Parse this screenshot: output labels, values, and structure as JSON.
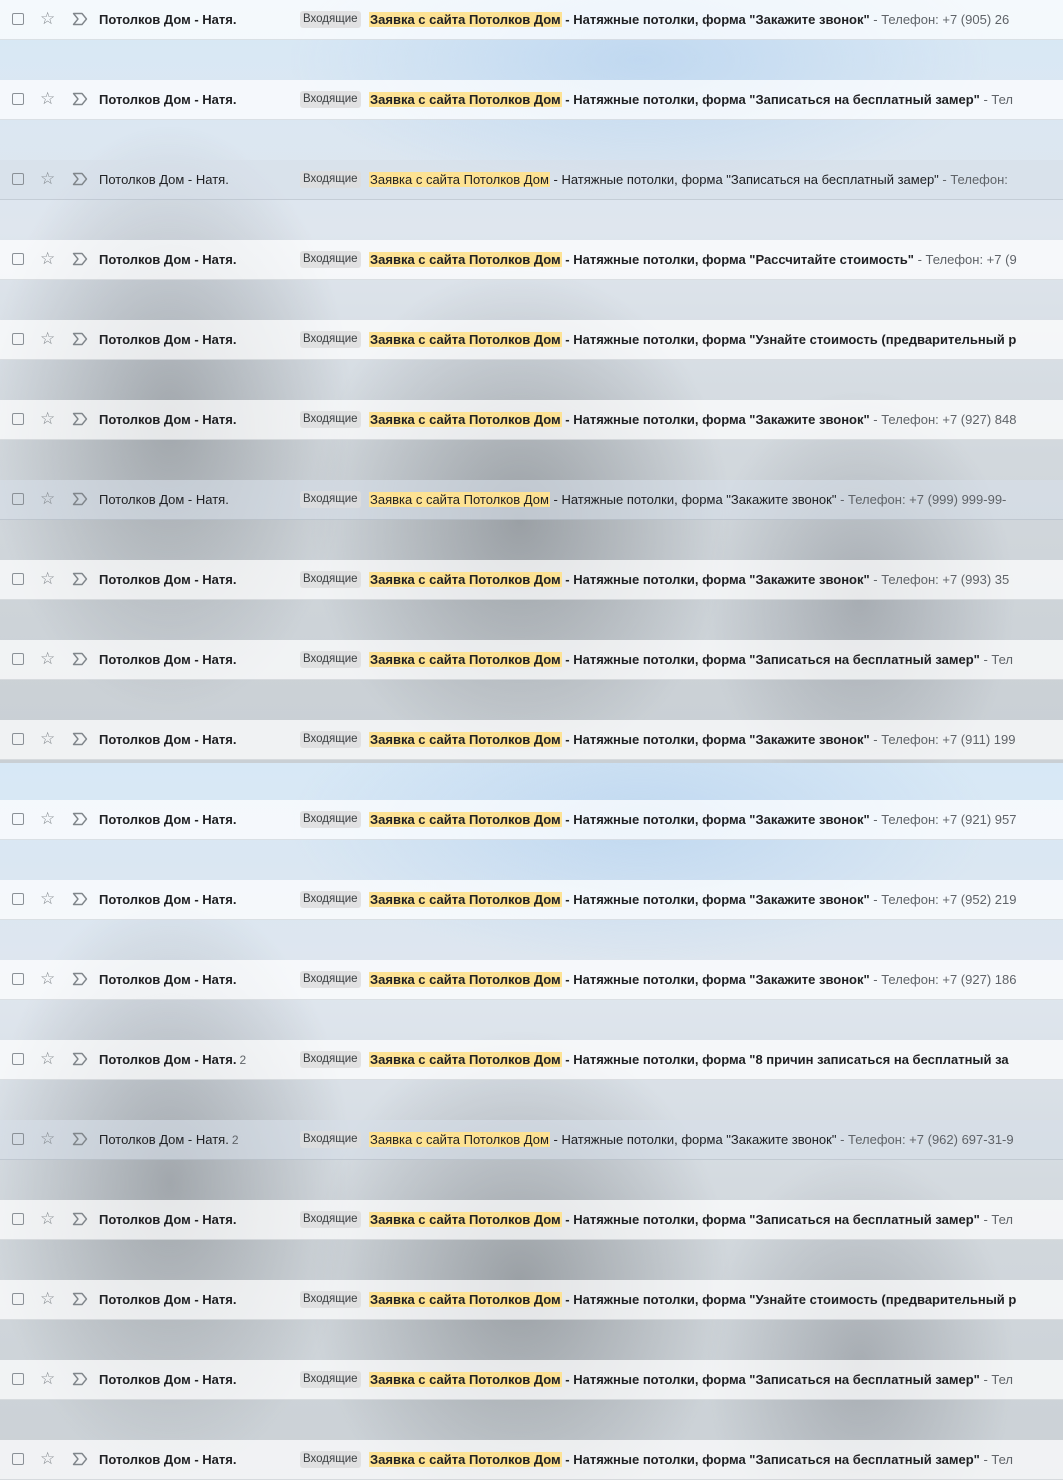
{
  "rows": [
    {
      "sender": "Потолков Дом - Натя.",
      "count": "",
      "label": "Входящие",
      "highlight": "Заявка с сайта Потолков Дом",
      "subject": " - Натяжные потолки, форма \"Закажите звонок\"",
      "snippet": " - Телефон: +7 (905) 26",
      "read": false
    },
    {
      "sender": "Потолков Дом - Натя.",
      "count": "",
      "label": "Входящие",
      "highlight": "Заявка с сайта Потолков Дом",
      "subject": " - Натяжные потолки, форма \"Записаться на бесплатный замер\"",
      "snippet": " - Тел",
      "read": false
    },
    {
      "sender": "Потолков Дом - Натя.",
      "count": "",
      "label": "Входящие",
      "highlight": "Заявка с сайта Потолков Дом",
      "subject": " - Натяжные потолки, форма \"Записаться на бесплатный замер\"",
      "snippet": " - Телефон:",
      "read": true
    },
    {
      "sender": "Потолков Дом - Натя.",
      "count": "",
      "label": "Входящие",
      "highlight": "Заявка с сайта Потолков Дом",
      "subject": " - Натяжные потолки, форма \"Рассчитайте стоимость\"",
      "snippet": " - Телефон: +7 (9",
      "read": false
    },
    {
      "sender": "Потолков Дом - Натя.",
      "count": "",
      "label": "Входящие",
      "highlight": "Заявка с сайта Потолков Дом",
      "subject": " - Натяжные потолки, форма \"Узнайте стоимость (предварительный р",
      "snippet": "",
      "read": false
    },
    {
      "sender": "Потолков Дом - Натя.",
      "count": "",
      "label": "Входящие",
      "highlight": "Заявка с сайта Потолков Дом",
      "subject": " - Натяжные потолки, форма \"Закажите звонок\"",
      "snippet": " - Телефон: +7 (927) 848",
      "read": false
    },
    {
      "sender": "Потолков Дом - Натя.",
      "count": "",
      "label": "Входящие",
      "highlight": "Заявка с сайта Потолков Дом",
      "subject": " - Натяжные потолки, форма \"Закажите звонок\"",
      "snippet": " - Телефон: +7 (999) 999-99-",
      "read": true
    },
    {
      "sender": "Потолков Дом - Натя.",
      "count": "",
      "label": "Входящие",
      "highlight": "Заявка с сайта Потолков Дом",
      "subject": " - Натяжные потолки, форма \"Закажите звонок\"",
      "snippet": " - Телефон: +7 (993) 35",
      "read": false
    },
    {
      "sender": "Потолков Дом - Натя.",
      "count": "",
      "label": "Входящие",
      "highlight": "Заявка с сайта Потолков Дом",
      "subject": " - Натяжные потолки, форма \"Записаться на бесплатный замер\"",
      "snippet": " - Тел",
      "read": false
    },
    {
      "sender": "Потолков Дом - Натя.",
      "count": "",
      "label": "Входящие",
      "highlight": "Заявка с сайта Потолков Дом",
      "subject": " - Натяжные потолки, форма \"Закажите звонок\"",
      "snippet": " - Телефон: +7 (911) 199",
      "read": false
    },
    {
      "sender": "Потолков Дом - Натя.",
      "count": "",
      "label": "Входящие",
      "highlight": "Заявка с сайта Потолков Дом",
      "subject": " - Натяжные потолки, форма \"Закажите звонок\"",
      "snippet": " - Телефон: +7 (921) 957",
      "read": false
    },
    {
      "sender": "Потолков Дом - Натя.",
      "count": "",
      "label": "Входящие",
      "highlight": "Заявка с сайта Потолков Дом",
      "subject": " - Натяжные потолки, форма \"Закажите звонок\"",
      "snippet": " - Телефон: +7 (952) 219",
      "read": false
    },
    {
      "sender": "Потолков Дом - Натя.",
      "count": "",
      "label": "Входящие",
      "highlight": "Заявка с сайта Потолков Дом",
      "subject": " - Натяжные потолки, форма \"Закажите звонок\"",
      "snippet": " - Телефон: +7 (927) 186",
      "read": false
    },
    {
      "sender": "Потолков Дом - Натя.",
      "count": "2",
      "label": "Входящие",
      "highlight": "Заявка с сайта Потолков Дом",
      "subject": " - Натяжные потолки, форма \"8 причин записаться на бесплатный за",
      "snippet": "",
      "read": false
    },
    {
      "sender": "Потолков Дом - Натя.",
      "count": "2",
      "label": "Входящие",
      "highlight": "Заявка с сайта Потолков Дом",
      "subject": " - Натяжные потолки, форма \"Закажите звонок\"",
      "snippet": " - Телефон: +7 (962) 697-31-9",
      "read": true
    },
    {
      "sender": "Потолков Дом - Натя.",
      "count": "",
      "label": "Входящие",
      "highlight": "Заявка с сайта Потолков Дом",
      "subject": " - Натяжные потолки, форма \"Записаться на бесплатный замер\"",
      "snippet": " - Тел",
      "read": false
    },
    {
      "sender": "Потолков Дом - Натя.",
      "count": "",
      "label": "Входящие",
      "highlight": "Заявка с сайта Потолков Дом",
      "subject": " - Натяжные потолки, форма \"Узнайте стоимость (предварительный р",
      "snippet": "",
      "read": false
    },
    {
      "sender": "Потолков Дом - Натя.",
      "count": "",
      "label": "Входящие",
      "highlight": "Заявка с сайта Потолков Дом",
      "subject": " - Натяжные потолки, форма \"Записаться на бесплатный замер\"",
      "snippet": " - Тел",
      "read": false
    },
    {
      "sender": "Потолков Дом - Натя.",
      "count": "",
      "label": "Входящие",
      "highlight": "Заявка с сайта Потолков Дом",
      "subject": " - Натяжные потолки, форма \"Записаться на бесплатный замер\"",
      "snippet": " - Тел",
      "read": false
    }
  ],
  "colors": {
    "highlight": "#fde293",
    "label_bg": "#dddddd",
    "snippet": "#5f6368"
  },
  "icons": {
    "checkbox": "checkbox-icon",
    "star": "star-icon",
    "importance": "importance-marker-icon"
  }
}
